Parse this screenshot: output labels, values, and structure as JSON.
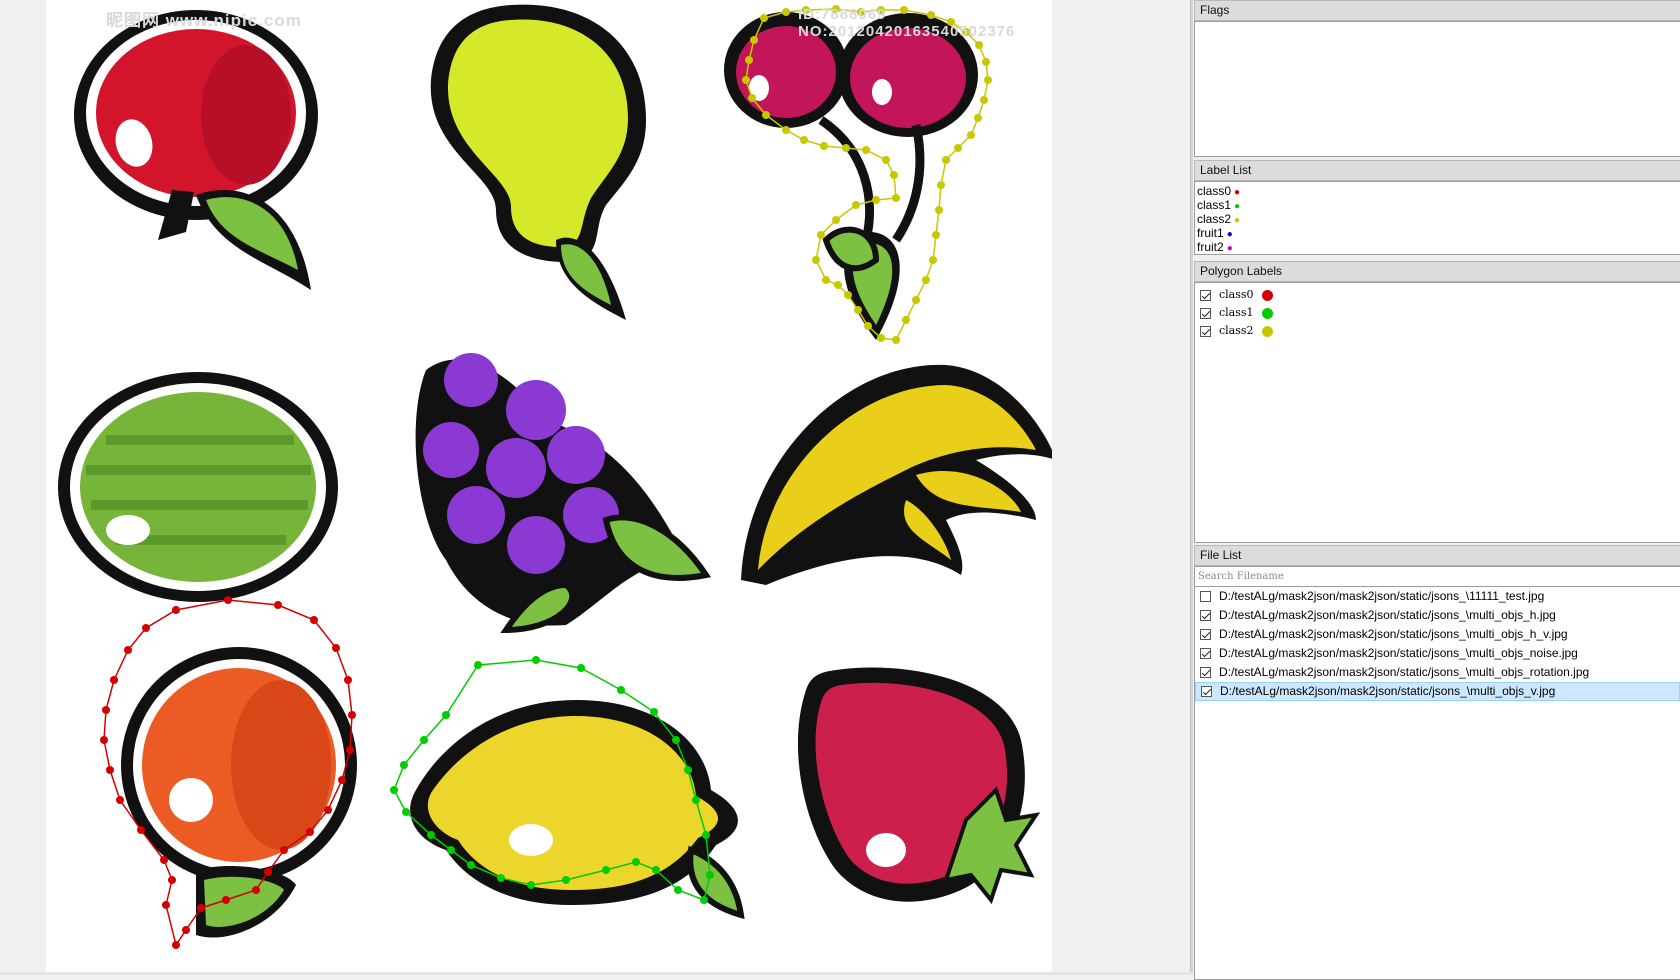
{
  "canvas": {
    "watermark_left": "昵图网 www.nipic.com",
    "watermark_right": "ID:7888069 NO:20120420163540502376"
  },
  "colors": {
    "class0": "#d40000",
    "class1": "#00cc00",
    "class2": "#c8c800",
    "fruit1": "#0000dd",
    "fruit2": "#cc00cc",
    "selection": "#cce8ff"
  },
  "docks": {
    "flags": {
      "title": "Flags"
    },
    "label_list": {
      "title": "Label List",
      "items": [
        {
          "label": "class0",
          "dot": "●",
          "color": "#d40000"
        },
        {
          "label": "class1",
          "dot": "●",
          "color": "#00cc00"
        },
        {
          "label": "class2",
          "dot": "●",
          "color": "#c8c800"
        },
        {
          "label": "fruit1",
          "dot": "●",
          "color": "#0000dd"
        },
        {
          "label": "fruit2",
          "dot": "●",
          "color": "#cc00cc"
        }
      ]
    },
    "polygon_labels": {
      "title": "Polygon Labels",
      "items": [
        {
          "label": "class0",
          "checked": true,
          "color": "#d40000"
        },
        {
          "label": "class1",
          "checked": true,
          "color": "#00cc00"
        },
        {
          "label": "class2",
          "checked": true,
          "color": "#c8c800"
        }
      ]
    },
    "file_list": {
      "title": "File List",
      "search_placeholder": "Search Filename",
      "files": [
        {
          "path": "D:/testALg/mask2json/mask2json/static/jsons_\\11111_test.jpg",
          "checked": false,
          "selected": false
        },
        {
          "path": "D:/testALg/mask2json/mask2json/static/jsons_\\multi_objs_h.jpg",
          "checked": true,
          "selected": false
        },
        {
          "path": "D:/testALg/mask2json/mask2json/static/jsons_\\multi_objs_h_v.jpg",
          "checked": true,
          "selected": false
        },
        {
          "path": "D:/testALg/mask2json/mask2json/static/jsons_\\multi_objs_noise.jpg",
          "checked": true,
          "selected": false
        },
        {
          "path": "D:/testALg/mask2json/mask2json/static/jsons_\\multi_objs_rotation.jpg",
          "checked": true,
          "selected": false
        },
        {
          "path": "D:/testALg/mask2json/mask2json/static/jsons_\\multi_objs_v.jpg",
          "checked": true,
          "selected": true
        }
      ]
    }
  }
}
